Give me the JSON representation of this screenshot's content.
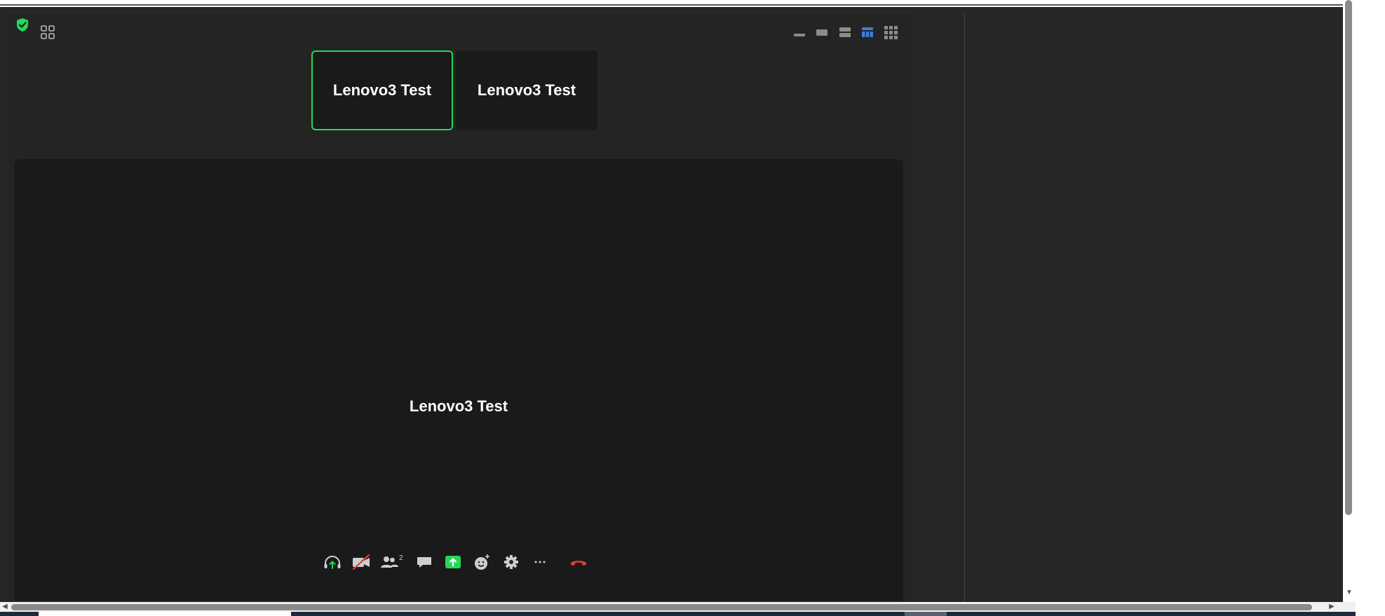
{
  "meeting": {
    "participants": [
      {
        "name": "Lenovo3 Test",
        "active": true
      },
      {
        "name": "Lenovo3 Test",
        "active": false
      }
    ],
    "main_speaker": "Lenovo3 Test",
    "participant_count": "2"
  },
  "icons": {
    "security": "shield-check-icon",
    "apps": "apps-grid-icon",
    "views": [
      "minimize-view-icon",
      "speaker-strip-view-icon",
      "split-view-icon",
      "gallery-view-icon",
      "grid-view-icon"
    ],
    "controls": [
      "audio-icon",
      "video-off-icon",
      "participants-icon",
      "chat-icon",
      "share-screen-icon",
      "reactions-icon",
      "settings-icon",
      "more-icon",
      "leave-icon"
    ]
  },
  "colors": {
    "accent_green": "#23d959",
    "active_view_blue": "#3b7fd9",
    "leave_red": "#e0403a",
    "background": "#242424",
    "tile": "#1a1a1a"
  }
}
